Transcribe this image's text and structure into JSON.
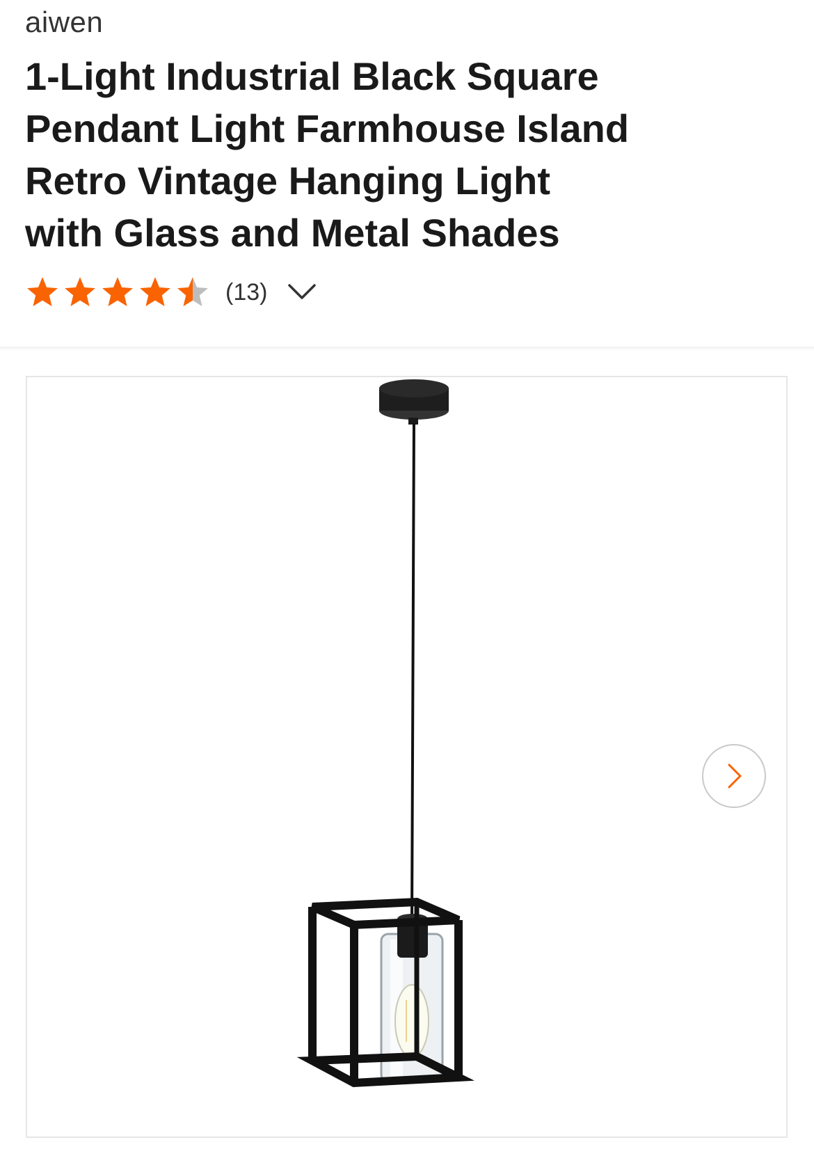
{
  "product": {
    "brand": "aiwen",
    "title_lines": [
      "1-Light Industrial Black Square",
      "Pendant Light Farmhouse Island",
      "Retro Vintage Hanging Light",
      "with Glass and Metal Shades"
    ]
  },
  "rating": {
    "stars": 4.5,
    "max_stars": 5,
    "review_count": "(13)",
    "star_color": "#f96302",
    "empty_star_color": "#bdbdbd"
  },
  "icons": {
    "expand": "chevron-down-icon",
    "next": "chevron-right-icon"
  },
  "colors": {
    "accent": "#f96302",
    "text": "#1a1a1a"
  }
}
